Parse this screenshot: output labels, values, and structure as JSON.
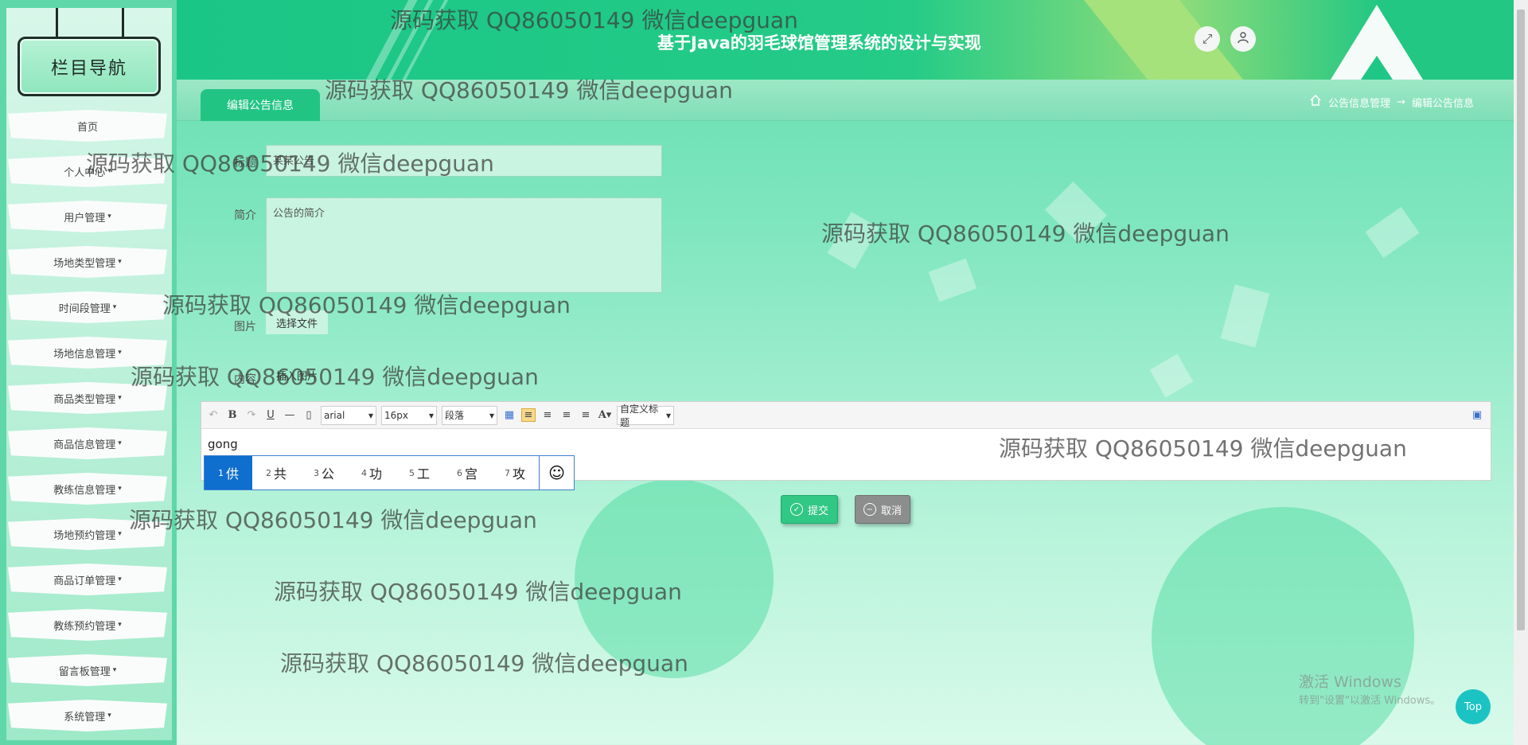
{
  "sidebar": {
    "title": "栏目导航",
    "items": [
      {
        "label": "首页",
        "has_caret": false
      },
      {
        "label": "个人中心",
        "has_caret": true
      },
      {
        "label": "用户管理",
        "has_caret": true
      },
      {
        "label": "场地类型管理",
        "has_caret": true
      },
      {
        "label": "时间段管理",
        "has_caret": true
      },
      {
        "label": "场地信息管理",
        "has_caret": true
      },
      {
        "label": "商品类型管理",
        "has_caret": true
      },
      {
        "label": "商品信息管理",
        "has_caret": true
      },
      {
        "label": "教练信息管理",
        "has_caret": true
      },
      {
        "label": "场地预约管理",
        "has_caret": true
      },
      {
        "label": "商品订单管理",
        "has_caret": true
      },
      {
        "label": "教练预约管理",
        "has_caret": true
      },
      {
        "label": "留言板管理",
        "has_caret": true
      },
      {
        "label": "系统管理",
        "has_caret": true
      }
    ]
  },
  "header": {
    "title": "基于Java的羽毛球馆管理系统的设计与实现",
    "fullscreen_icon": "fullscreen-icon",
    "user_icon": "user-icon"
  },
  "tabbar": {
    "active_tab": "编辑公告信息",
    "breadcrumb": {
      "home_icon": "home-icon",
      "parent": "公告信息管理",
      "arrow": "→",
      "current": "编辑公告信息"
    }
  },
  "form": {
    "title_label": "标题",
    "title_value": "某某公告",
    "intro_label": "简介",
    "intro_value": "公告的简介",
    "image_label": "图片",
    "image_button": "选择文件",
    "content_label": "内容",
    "content_button": "插入图片",
    "editor": {
      "font_family": "arial",
      "font_size": "16px",
      "paragraph": "段落",
      "custom_title": "自定义标题",
      "text": "gong"
    },
    "ime": {
      "candidates": [
        {
          "n": "1",
          "c": "供"
        },
        {
          "n": "2",
          "c": "共"
        },
        {
          "n": "3",
          "c": "公"
        },
        {
          "n": "4",
          "c": "功"
        },
        {
          "n": "5",
          "c": "工"
        },
        {
          "n": "6",
          "c": "宫"
        },
        {
          "n": "7",
          "c": "攻"
        }
      ],
      "emoji": "☺"
    },
    "submit_label": "提交",
    "cancel_label": "取消"
  },
  "watermark": "源码获取 QQ86050149 微信deepguan",
  "windows_activation": {
    "line1": "激活 Windows",
    "line2": "转到\"设置\"以激活 Windows。"
  },
  "top_button": "Top",
  "colors": {
    "brand_green": "#22c484",
    "submit_green": "#31c784",
    "cancel_grey": "#8b8e8c",
    "ime_blue": "#0f6fce"
  }
}
